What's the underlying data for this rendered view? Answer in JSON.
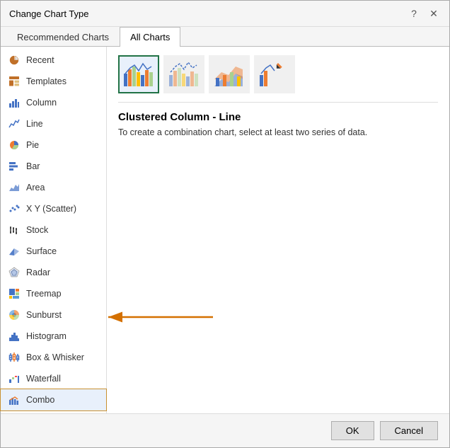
{
  "dialog": {
    "title": "Change Chart Type",
    "help_btn": "?",
    "close_btn": "✕"
  },
  "tabs": [
    {
      "label": "Recommended Charts",
      "active": false
    },
    {
      "label": "All Charts",
      "active": true
    }
  ],
  "sidebar": {
    "items": [
      {
        "label": "Recent",
        "icon": "recent-icon"
      },
      {
        "label": "Templates",
        "icon": "templates-icon"
      },
      {
        "label": "Column",
        "icon": "column-icon"
      },
      {
        "label": "Line",
        "icon": "line-icon"
      },
      {
        "label": "Pie",
        "icon": "pie-icon"
      },
      {
        "label": "Bar",
        "icon": "bar-icon"
      },
      {
        "label": "Area",
        "icon": "area-icon"
      },
      {
        "label": "X Y (Scatter)",
        "icon": "scatter-icon"
      },
      {
        "label": "Stock",
        "icon": "stock-icon"
      },
      {
        "label": "Surface",
        "icon": "surface-icon"
      },
      {
        "label": "Radar",
        "icon": "radar-icon"
      },
      {
        "label": "Treemap",
        "icon": "treemap-icon"
      },
      {
        "label": "Sunburst",
        "icon": "sunburst-icon"
      },
      {
        "label": "Histogram",
        "icon": "histogram-icon"
      },
      {
        "label": "Box & Whisker",
        "icon": "box-whisker-icon"
      },
      {
        "label": "Waterfall",
        "icon": "waterfall-icon"
      },
      {
        "label": "Combo",
        "icon": "combo-icon",
        "selected": true
      }
    ]
  },
  "main": {
    "chart_options": [
      {
        "label": "Clustered Column - Line",
        "selected": true
      },
      {
        "label": "Clustered Column - Line on Secondary Axis",
        "selected": false
      },
      {
        "label": "Stacked Area - Clustered Column",
        "selected": false
      },
      {
        "label": "Custom Combination",
        "selected": false
      }
    ],
    "selected_chart_title": "Clustered Column - Line",
    "selected_chart_desc": "To create a combination chart, select at least two series of data."
  },
  "footer": {
    "ok_label": "OK",
    "cancel_label": "Cancel"
  }
}
